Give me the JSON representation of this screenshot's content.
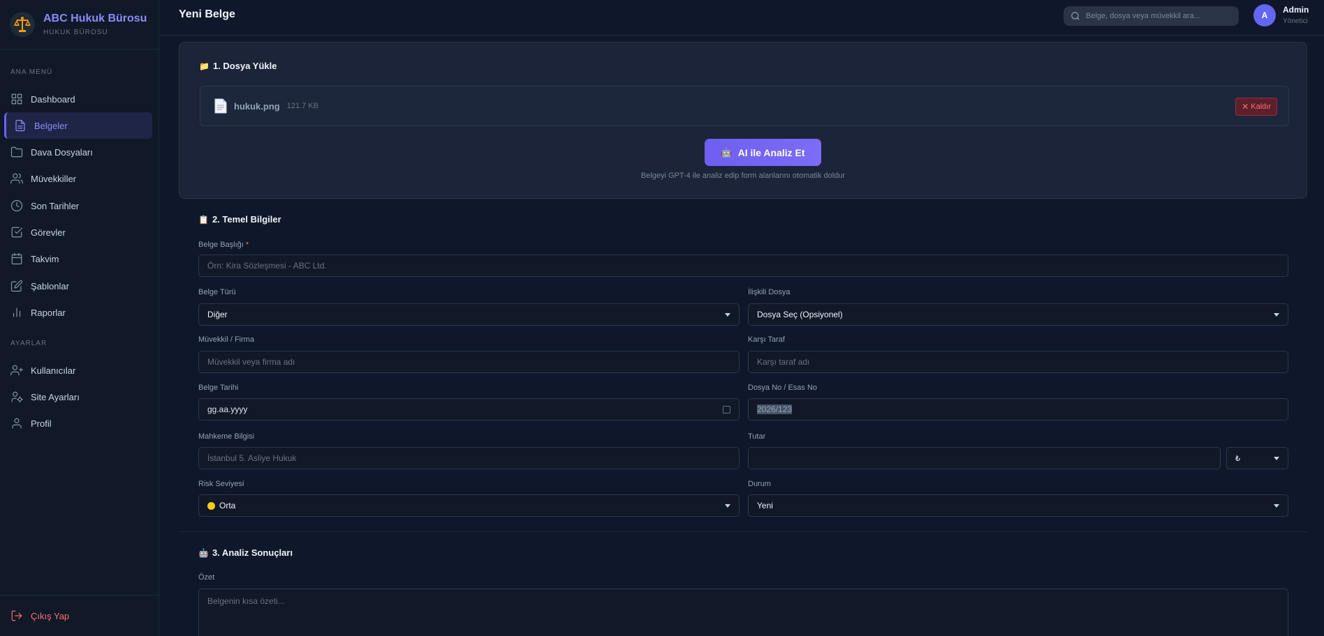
{
  "brand": {
    "title": "ABC Hukuk Bürosu",
    "subtitle": "HUKUK BÜROSU"
  },
  "sidebar": {
    "section_main": "ANA MENÜ",
    "items": [
      {
        "label": "Dashboard",
        "icon": "grid-icon"
      },
      {
        "label": "Belgeler",
        "icon": "document-icon",
        "active": true
      },
      {
        "label": "Dava Dosyaları",
        "icon": "folder-icon"
      },
      {
        "label": "Müvekkiller",
        "icon": "users-icon"
      },
      {
        "label": "Son Tarihler",
        "icon": "clock-icon"
      },
      {
        "label": "Görevler",
        "icon": "check-square-icon"
      },
      {
        "label": "Takvim",
        "icon": "calendar-icon"
      },
      {
        "label": "Şablonlar",
        "icon": "edit-icon"
      },
      {
        "label": "Raporlar",
        "icon": "bar-chart-icon"
      }
    ],
    "section_settings": "AYARLAR",
    "settings_items": [
      {
        "label": "Kullanıcılar",
        "icon": "user-plus-icon"
      },
      {
        "label": "Site Ayarları",
        "icon": "user-cog-icon"
      },
      {
        "label": "Profil",
        "icon": "user-icon"
      }
    ],
    "logout": "Çıkış Yap"
  },
  "header": {
    "title": "Yeni Belge",
    "search_placeholder": "Belge, dosya veya müvekkil ara...",
    "avatar_initial": "A",
    "user_name": "Admin",
    "user_role": "Yönetici"
  },
  "upload": {
    "title": "1. Dosya Yükle",
    "file_name": "hukuk.png",
    "file_size": "121.7 KB",
    "remove_label": "Kaldır",
    "ai_button": "AI ile Analiz Et",
    "ai_hint": "Belgeyi GPT-4 ile analiz edip form alanlarını otomatik doldur"
  },
  "basic": {
    "title": "2. Temel Bilgiler",
    "doc_title_label": "Belge Başlığı",
    "doc_title_placeholder": "Örn: Kira Sözleşmesi - ABC Ltd.",
    "doc_type_label": "Belge Türü",
    "doc_type_value": "Diğer",
    "related_case_label": "İlişkili Dosya",
    "related_case_value": "Dosya Seç (Opsiyonel)",
    "client_label": "Müvekkil / Firma",
    "client_placeholder": "Müvekkil veya firma adı",
    "opponent_label": "Karşı Taraf",
    "opponent_placeholder": "Karşı taraf adı",
    "date_label": "Belge Tarihi",
    "date_value": "gg.aa.yyyy",
    "file_no_label": "Dosya No / Esas No",
    "file_no_value": "2026/123",
    "court_label": "Mahkeme Bilgisi",
    "court_placeholder": "İstanbul 5. Asliye Hukuk",
    "amount_label": "Tutar",
    "currency_value": "₺",
    "risk_label": "Risk Seviyesi",
    "risk_value": "Orta",
    "risk_color": "#facc15",
    "status_label": "Durum",
    "status_value": "Yeni"
  },
  "analysis": {
    "title": "3. Analiz Sonuçları",
    "summary_label": "Özet",
    "summary_placeholder": "Belgenin kısa özeti..."
  }
}
